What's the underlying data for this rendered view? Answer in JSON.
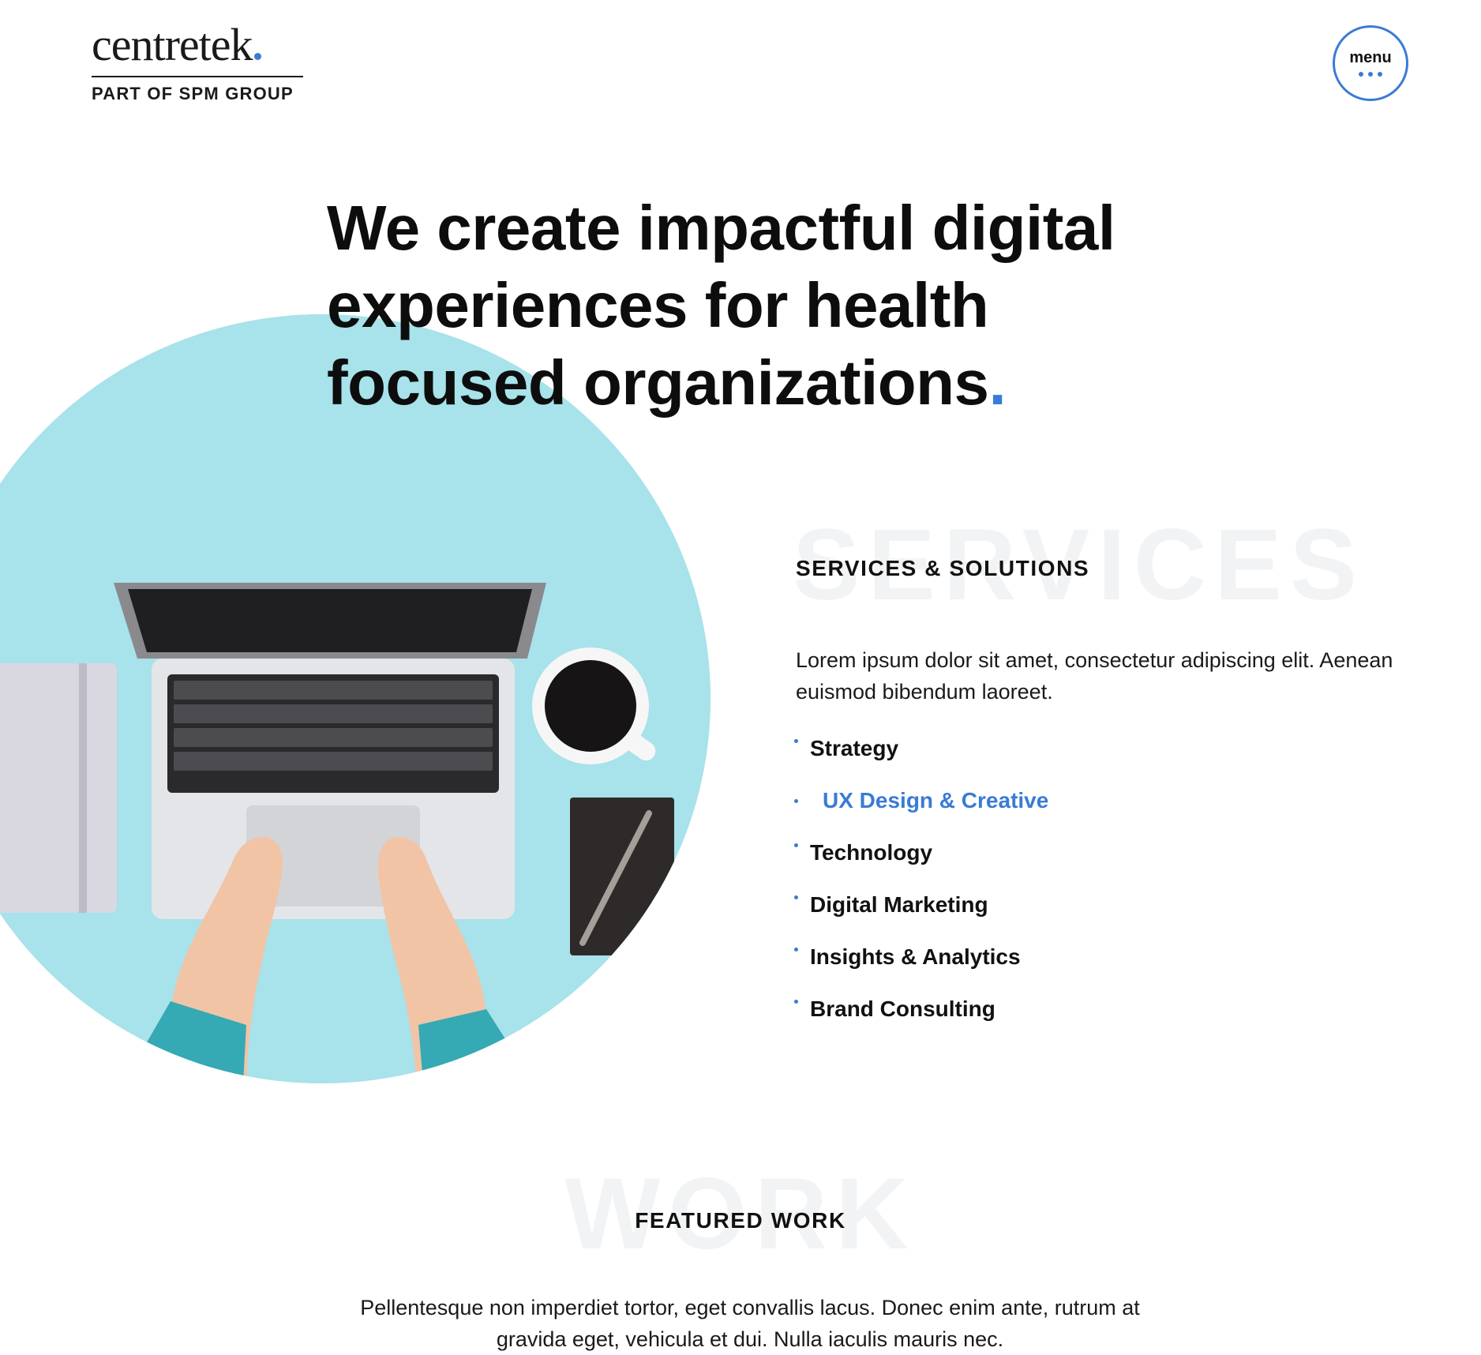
{
  "header": {
    "logo_word": "centretek",
    "logo_subtitle": "PART OF SPM GROUP",
    "menu_label": "menu"
  },
  "hero": {
    "title_main": "We create impactful digital experiences for health focused organizations",
    "title_dot": ".",
    "image_icon": "laptop-workspace-photo"
  },
  "services": {
    "background_word": "SERVICES",
    "heading": "SERVICES & SOLUTIONS",
    "body": "Lorem ipsum dolor sit amet, consectetur adipiscing elit. Aenean euismod bibendum laoreet.",
    "items": [
      {
        "label": "Strategy"
      },
      {
        "label": "UX Design & Creative"
      },
      {
        "label": "Technology"
      },
      {
        "label": "Digital Marketing"
      },
      {
        "label": "Insights & Analytics"
      },
      {
        "label": "Brand Consulting"
      }
    ],
    "active_index": 1
  },
  "featured": {
    "background_word": "WORK",
    "heading": "FEATURED WORK",
    "body": "Pellentesque non imperdiet tortor, eget convallis lacus. Donec enim ante, rutrum at gravida eget, vehicula et dui. Nulla iaculis mauris nec."
  },
  "colors": {
    "accent": "#3a7bd5",
    "hero_circle": "#a8e2eb",
    "text": "#111111",
    "watermark": "#f1f3f5"
  }
}
